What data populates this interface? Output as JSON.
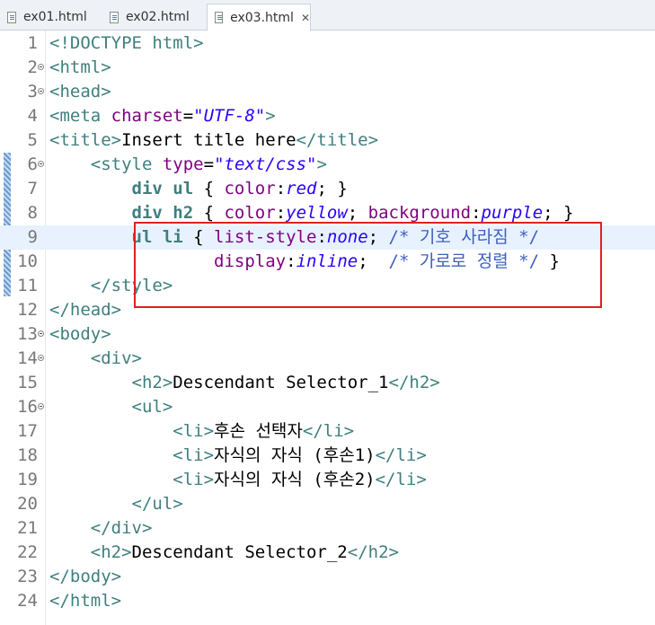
{
  "tabs": [
    {
      "label": "ex01.html"
    },
    {
      "label": "ex02.html"
    },
    {
      "label": "ex03.html",
      "active": true
    }
  ],
  "current_line": 9,
  "lines": [
    {
      "n": "1",
      "fold": false,
      "tokens": [
        [
          "tg",
          "<!DOCTYPE html>"
        ]
      ]
    },
    {
      "n": "2",
      "fold": true,
      "tokens": [
        [
          "tg",
          "<html>"
        ]
      ]
    },
    {
      "n": "3",
      "fold": true,
      "tokens": [
        [
          "tg",
          "<head>"
        ]
      ]
    },
    {
      "n": "4",
      "fold": false,
      "tokens": [
        [
          "tg",
          "<meta "
        ],
        [
          "at",
          "charset"
        ],
        [
          "tx",
          "="
        ],
        [
          "av",
          "\"UTF-8\""
        ],
        [
          "tg",
          ">"
        ]
      ]
    },
    {
      "n": "5",
      "fold": false,
      "tokens": [
        [
          "tg",
          "<title>"
        ],
        [
          "tx",
          "Insert title here"
        ],
        [
          "tg",
          "</title>"
        ]
      ]
    },
    {
      "n": "6",
      "fold": true,
      "tokens": [
        [
          "tx",
          "    "
        ],
        [
          "tg",
          "<style "
        ],
        [
          "at",
          "type"
        ],
        [
          "tx",
          "="
        ],
        [
          "av",
          "\"text/css\""
        ],
        [
          "tg",
          ">"
        ]
      ]
    },
    {
      "n": "7",
      "fold": false,
      "tokens": [
        [
          "tx",
          "        "
        ],
        [
          "sel",
          "div ul"
        ],
        [
          "tx",
          " { "
        ],
        [
          "pr",
          "color"
        ],
        [
          "tx",
          ":"
        ],
        [
          "vl",
          "red"
        ],
        [
          "tx",
          "; }"
        ]
      ]
    },
    {
      "n": "8",
      "fold": false,
      "tokens": [
        [
          "tx",
          "        "
        ],
        [
          "sel",
          "div h2"
        ],
        [
          "tx",
          " { "
        ],
        [
          "pr",
          "color"
        ],
        [
          "tx",
          ":"
        ],
        [
          "vl",
          "yellow"
        ],
        [
          "tx",
          "; "
        ],
        [
          "pr",
          "background"
        ],
        [
          "tx",
          ":"
        ],
        [
          "vl",
          "purple"
        ],
        [
          "tx",
          "; }"
        ]
      ]
    },
    {
      "n": "9",
      "fold": false,
      "tokens": [
        [
          "tx",
          "        "
        ],
        [
          "sel",
          "ul li"
        ],
        [
          "tx",
          " { "
        ],
        [
          "pr",
          "list-style"
        ],
        [
          "tx",
          ":"
        ],
        [
          "vl",
          "none"
        ],
        [
          "tx",
          "; "
        ],
        [
          "cm",
          "/* 기호 사라짐 */"
        ]
      ]
    },
    {
      "n": "10",
      "fold": false,
      "tokens": [
        [
          "tx",
          "                "
        ],
        [
          "pr",
          "display"
        ],
        [
          "tx",
          ":"
        ],
        [
          "vl",
          "inline"
        ],
        [
          "tx",
          ";  "
        ],
        [
          "cm",
          "/* 가로로 정렬 */"
        ],
        [
          "tx",
          " }"
        ]
      ]
    },
    {
      "n": "11",
      "fold": false,
      "tokens": [
        [
          "tx",
          "    "
        ],
        [
          "tg",
          "</style>"
        ]
      ]
    },
    {
      "n": "12",
      "fold": false,
      "tokens": [
        [
          "tg",
          "</head>"
        ]
      ]
    },
    {
      "n": "13",
      "fold": true,
      "tokens": [
        [
          "tg",
          "<body>"
        ]
      ]
    },
    {
      "n": "14",
      "fold": true,
      "tokens": [
        [
          "tx",
          "    "
        ],
        [
          "tg",
          "<div>"
        ]
      ]
    },
    {
      "n": "15",
      "fold": false,
      "tokens": [
        [
          "tx",
          "        "
        ],
        [
          "tg",
          "<h2>"
        ],
        [
          "tx",
          "Descendant Selector_1"
        ],
        [
          "tg",
          "</h2>"
        ]
      ]
    },
    {
      "n": "16",
      "fold": true,
      "tokens": [
        [
          "tx",
          "        "
        ],
        [
          "tg",
          "<ul>"
        ]
      ]
    },
    {
      "n": "17",
      "fold": false,
      "tokens": [
        [
          "tx",
          "            "
        ],
        [
          "tg",
          "<li>"
        ],
        [
          "tx",
          "후손 선택자"
        ],
        [
          "tg",
          "</li>"
        ]
      ]
    },
    {
      "n": "18",
      "fold": false,
      "tokens": [
        [
          "tx",
          "            "
        ],
        [
          "tg",
          "<li>"
        ],
        [
          "tx",
          "자식의 자식 (후손1)"
        ],
        [
          "tg",
          "</li>"
        ]
      ]
    },
    {
      "n": "19",
      "fold": false,
      "tokens": [
        [
          "tx",
          "            "
        ],
        [
          "tg",
          "<li>"
        ],
        [
          "tx",
          "자식의 자식 (후손2)"
        ],
        [
          "tg",
          "</li>"
        ]
      ]
    },
    {
      "n": "20",
      "fold": false,
      "tokens": [
        [
          "tx",
          "        "
        ],
        [
          "tg",
          "</ul>"
        ]
      ]
    },
    {
      "n": "21",
      "fold": false,
      "tokens": [
        [
          "tx",
          "    "
        ],
        [
          "tg",
          "</div>"
        ]
      ]
    },
    {
      "n": "22",
      "fold": false,
      "tokens": [
        [
          "tx",
          "    "
        ],
        [
          "tg",
          "<h2>"
        ],
        [
          "tx",
          "Descendant Selector_2"
        ],
        [
          "tg",
          "</h2>"
        ]
      ]
    },
    {
      "n": "23",
      "fold": false,
      "tokens": [
        [
          "tg",
          "</body>"
        ]
      ]
    },
    {
      "n": "24",
      "fold": false,
      "tokens": [
        [
          "tg",
          "</html>"
        ]
      ]
    }
  ],
  "colors": {
    "tag": "#3f7f7f",
    "attribute": "#7f007f",
    "attribute_value": "#2a00ff",
    "comment": "#3f5fbf",
    "current_line_bg": "#e8f2fe",
    "annotation_box": "#e02020"
  },
  "icons": {
    "tab_file": "file-icon",
    "tab_close": "close-icon"
  }
}
